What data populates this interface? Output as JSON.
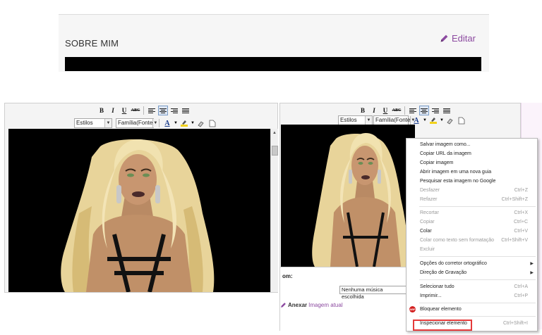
{
  "about": {
    "title": "SOBRE MIM",
    "edit_label": "Editar"
  },
  "colors": {
    "accent": "#8c4aa0",
    "inspect_highlight": "#e53a3a",
    "canvas_bg": "#000000"
  },
  "toolbar": {
    "bold": "B",
    "italic": "I",
    "underline": "U",
    "strike": "ABC",
    "styles_combo": "Estilos",
    "font_combo_left": "Família(Fonte",
    "font_combo_right": "Família(Fonte",
    "text_color_glyph": "A"
  },
  "right_editor": {
    "om_label": "om:",
    "music_select": "Nenhuma música escolhida",
    "attach_label": "Anexar",
    "current_image_label": "Imagem atual"
  },
  "context_menu": {
    "items": [
      {
        "label": "Salvar imagem como...",
        "shortcut": ""
      },
      {
        "label": "Copiar URL da imagem",
        "shortcut": ""
      },
      {
        "label": "Copiar imagem",
        "shortcut": ""
      },
      {
        "label": "Abrir imagem em uma nova guia",
        "shortcut": ""
      },
      {
        "label": "Pesquisar esta imagem no Google",
        "shortcut": ""
      },
      {
        "label": "Desfazer",
        "shortcut": "Ctrl+Z"
      },
      {
        "label": "Refazer",
        "shortcut": "Ctrl+Shift+Z"
      },
      {
        "label": "Recortar",
        "shortcut": "Ctrl+X"
      },
      {
        "label": "Copiar",
        "shortcut": "Ctrl+C"
      },
      {
        "label": "Colar",
        "shortcut": "Ctrl+V"
      },
      {
        "label": "Colar como texto sem formatação",
        "shortcut": "Ctrl+Shift+V"
      },
      {
        "label": "Excluir",
        "shortcut": ""
      },
      {
        "label": "Opções do corretor ortográfico",
        "shortcut": ""
      },
      {
        "label": "Direção de Gravação",
        "shortcut": ""
      },
      {
        "label": "Selecionar tudo",
        "shortcut": "Ctrl+A"
      },
      {
        "label": "Imprimir...",
        "shortcut": "Ctrl+P"
      },
      {
        "label": "Bloquear elemento",
        "shortcut": ""
      },
      {
        "label": "Inspecionar elemento",
        "shortcut": "Ctrl+Shift+I"
      }
    ],
    "abp_icon_text": "ABP"
  }
}
